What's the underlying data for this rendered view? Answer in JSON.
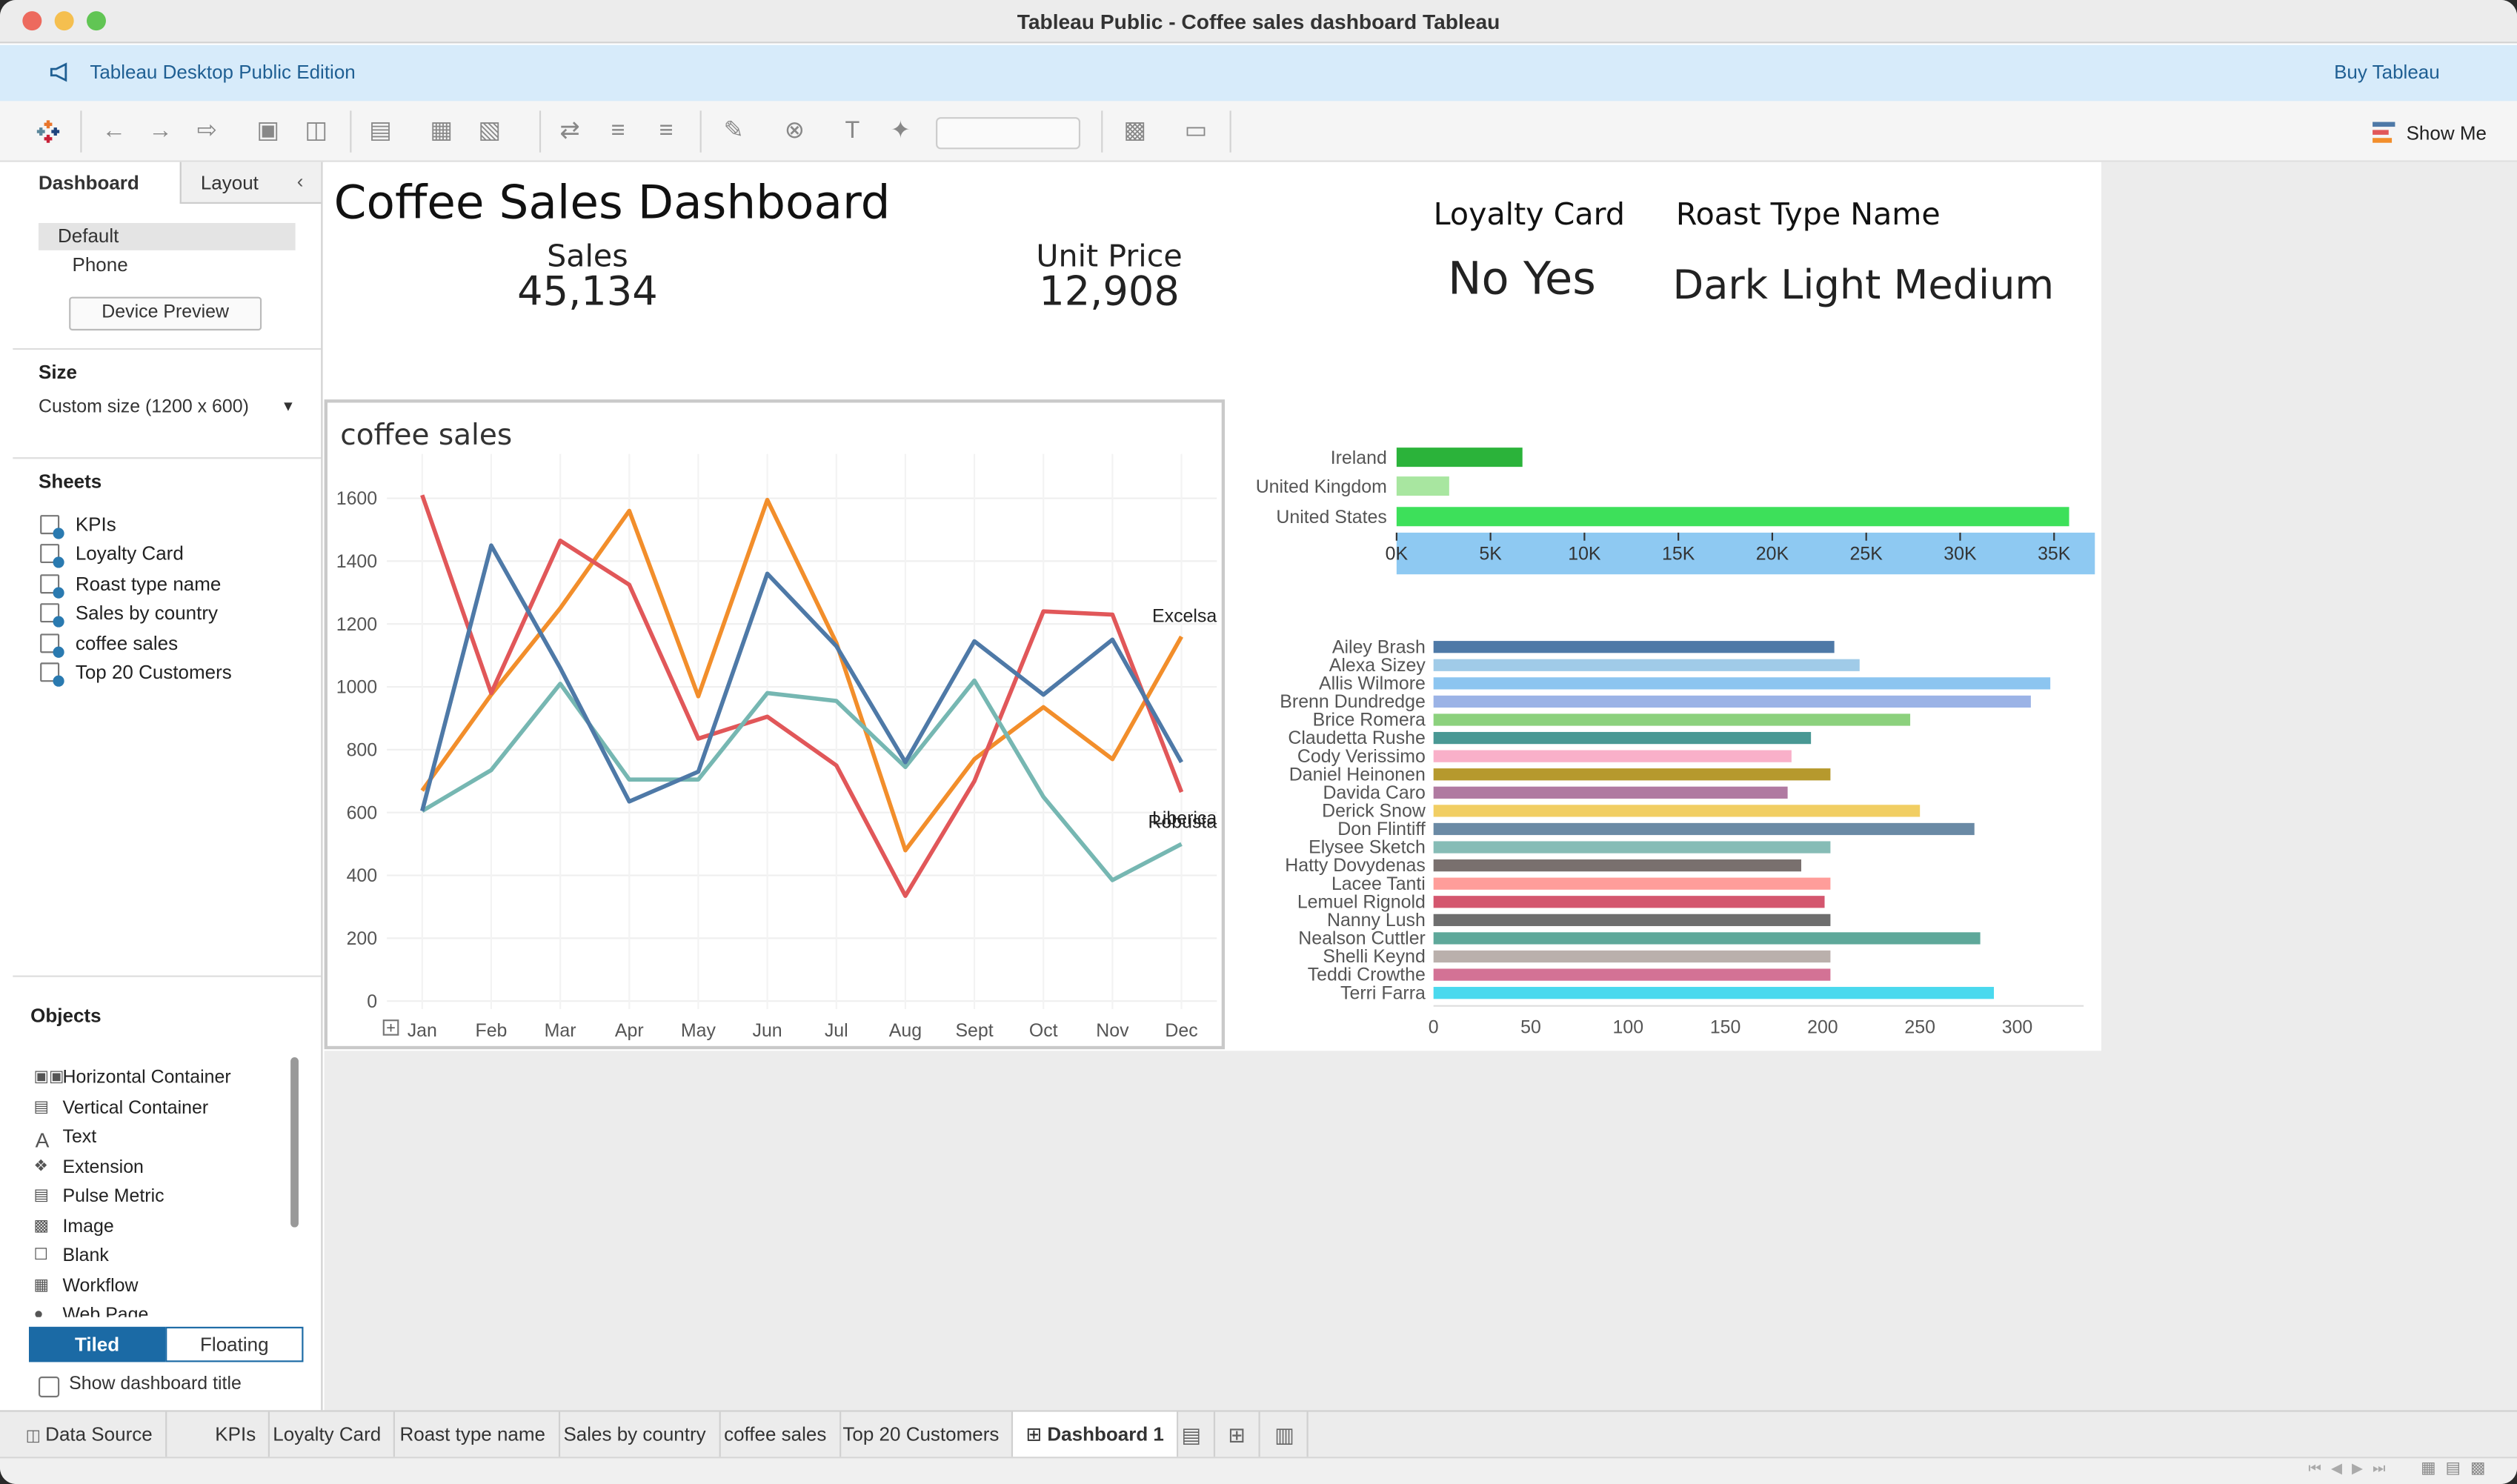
{
  "window": {
    "title": "Tableau Public - Coffee sales dashboard Tableau"
  },
  "banner": {
    "edition": "Tableau Desktop Public Edition",
    "buy": "Buy Tableau"
  },
  "toolbar": {
    "show_me": "Show Me"
  },
  "left_panel": {
    "tabs": [
      "Dashboard",
      "Layout"
    ],
    "device": {
      "default": "Default",
      "phone": "Phone",
      "preview_button": "Device Preview"
    },
    "size": {
      "heading": "Size",
      "value": "Custom size (1200 x 600)"
    },
    "sheets": {
      "heading": "Sheets",
      "items": [
        "KPIs",
        "Loyalty Card",
        "Roast type name",
        "Sales by country",
        "coffee sales",
        "Top 20 Customers"
      ]
    },
    "objects": {
      "heading": "Objects",
      "items": [
        "Horizontal Container",
        "Vertical Container",
        "Text",
        "Extension",
        "Pulse Metric",
        "Image",
        "Blank",
        "Workflow",
        "Web Page"
      ]
    },
    "layout_mode": {
      "tiled": "Tiled",
      "floating": "Floating"
    },
    "show_title": "Show dashboard title"
  },
  "dashboard": {
    "title": "Coffee Sales Dashboard",
    "kpis": [
      {
        "label": "Sales",
        "value": "45,134"
      },
      {
        "label": "Unit Price",
        "value": "12,908"
      }
    ],
    "loyalty": {
      "heading": "Loyalty Card",
      "values": "No Yes"
    },
    "roast": {
      "heading": "Roast Type Name",
      "values": "Dark Light Medium"
    }
  },
  "chart_data": [
    {
      "type": "line",
      "title": "coffee sales",
      "categories": [
        "Jan",
        "Feb",
        "Mar",
        "Apr",
        "May",
        "Jun",
        "Jul",
        "Aug",
        "Sept",
        "Oct",
        "Nov",
        "Dec"
      ],
      "ylim": [
        0,
        1700
      ],
      "yticks": [
        0,
        200,
        400,
        600,
        800,
        1000,
        1200,
        1400,
        1600
      ],
      "grid": true,
      "series": [
        {
          "name": "Excelsa",
          "color": "#f28e2b",
          "values": [
            670,
            975,
            1250,
            1560,
            970,
            1595,
            1140,
            480,
            770,
            935,
            770,
            1160
          ]
        },
        {
          "name": "Liberica",
          "color": "#e15759",
          "values": [
            1610,
            980,
            1465,
            1325,
            835,
            905,
            750,
            335,
            700,
            1240,
            1230,
            665
          ]
        },
        {
          "name": "Robusta",
          "color": "#76b7b2",
          "values": [
            605,
            735,
            1010,
            705,
            705,
            980,
            955,
            745,
            1020,
            650,
            385,
            500
          ]
        },
        {
          "name": "",
          "color": "#4e79a7",
          "values": [
            605,
            1450,
            1060,
            635,
            730,
            1360,
            1130,
            760,
            1145,
            975,
            1150,
            760
          ]
        }
      ]
    },
    {
      "type": "bar",
      "orientation": "horizontal",
      "categories": [
        "Ireland",
        "United Kingdom",
        "United States"
      ],
      "values": [
        6700,
        2800,
        35800
      ],
      "colors": [
        "#2bb33a",
        "#a8e6a0",
        "#3de05a"
      ],
      "xlim": [
        0,
        37000
      ],
      "xticks": [
        "0K",
        "5K",
        "10K",
        "15K",
        "20K",
        "25K",
        "30K",
        "35K"
      ],
      "xtick_values": [
        0,
        5000,
        10000,
        15000,
        20000,
        25000,
        30000,
        35000
      ]
    },
    {
      "type": "bar",
      "orientation": "horizontal",
      "categories": [
        "Ailey Brash",
        "Alexa Sizey",
        "Allis Wilmore",
        "Brenn Dundredge",
        "Brice Romera",
        "Claudetta Rushe",
        "Cody Verissimo",
        "Daniel Heinonen",
        "Davida Caro",
        "Derick Snow",
        "Don Flintiff",
        "Elysee Sketch",
        "Hatty Dovydenas",
        "Lacee Tanti",
        "Lemuel Rignold",
        "Nanny Lush",
        "Nealson Cuttler",
        "Shelli Keynd",
        "Teddi Crowthe",
        "Terri Farra"
      ],
      "values": [
        206,
        219,
        317,
        307,
        245,
        194,
        184,
        204,
        182,
        250,
        278,
        204,
        189,
        204,
        201,
        204,
        281,
        204,
        204,
        288
      ],
      "colors": [
        "#4e79a7",
        "#a0cbe8",
        "#8cc5f0",
        "#9bb3e6",
        "#8cd17d",
        "#499894",
        "#f9b0c9",
        "#b6992d",
        "#b07aa1",
        "#f1ce63",
        "#6a8aa5",
        "#86bcb6",
        "#79706e",
        "#ff9d9a",
        "#d4566e",
        "#6e6e6e",
        "#5ea89a",
        "#bab0ac",
        "#d37295",
        "#4ad9ee"
      ],
      "xlim": [
        0,
        330
      ],
      "xticks": [
        0,
        50,
        100,
        150,
        200,
        250,
        300
      ]
    }
  ],
  "bottom_tabs": [
    "Data Source",
    "KPIs",
    "Loyalty Card",
    "Roast type name",
    "Sales by country",
    "coffee sales",
    "Top 20 Customers",
    "Dashboard 1"
  ]
}
